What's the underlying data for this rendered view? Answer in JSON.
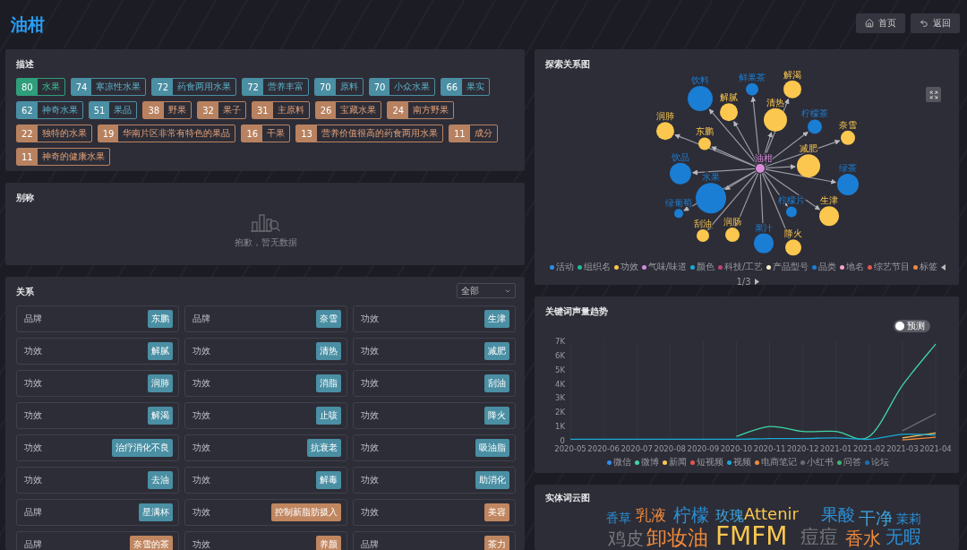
{
  "header": {
    "title": "油柑",
    "buttons": [
      {
        "kind": "home",
        "label": "首页"
      },
      {
        "kind": "back",
        "label": "返回"
      }
    ]
  },
  "description": {
    "title": "描述",
    "tags": [
      {
        "count": "80",
        "label": "水果",
        "color": "#2f9e7a"
      },
      {
        "count": "74",
        "label": "寒凉性水果",
        "color": "#4a8fa3"
      },
      {
        "count": "72",
        "label": "药食两用水果",
        "color": "#4a8fa3"
      },
      {
        "count": "72",
        "label": "营养丰富",
        "color": "#4a8fa3"
      },
      {
        "count": "70",
        "label": "原料",
        "color": "#4a8fa3"
      },
      {
        "count": "70",
        "label": "小众水果",
        "color": "#4a8fa3"
      },
      {
        "count": "66",
        "label": "果实",
        "color": "#4a8fa3"
      },
      {
        "count": "62",
        "label": "神奇水果",
        "color": "#4a8fa3"
      },
      {
        "count": "51",
        "label": "果品",
        "color": "#4a8fa3"
      },
      {
        "count": "38",
        "label": "野果",
        "color": "#b88260"
      },
      {
        "count": "32",
        "label": "果子",
        "color": "#b88260"
      },
      {
        "count": "31",
        "label": "主原料",
        "color": "#b88260"
      },
      {
        "count": "26",
        "label": "宝藏水果",
        "color": "#b88260"
      },
      {
        "count": "24",
        "label": "南方野果",
        "color": "#b88260"
      },
      {
        "count": "22",
        "label": "独特的水果",
        "color": "#b88260"
      },
      {
        "count": "19",
        "label": "华南片区非常有特色的果品",
        "color": "#b88260"
      },
      {
        "count": "16",
        "label": "干果",
        "color": "#b88260"
      },
      {
        "count": "13",
        "label": "营养价值很高的药食两用水果",
        "color": "#b88260"
      },
      {
        "count": "11",
        "label": "成分",
        "color": "#b88260"
      },
      {
        "count": "11",
        "label": "神奇的健康水果",
        "color": "#b88260"
      }
    ]
  },
  "alias": {
    "title": "别称",
    "empty_text": "抱歉，暂无数据"
  },
  "relations": {
    "title": "关系",
    "filter": "全部",
    "items": [
      {
        "type": "品牌",
        "value": "东鹏",
        "color": "#4a8fa3"
      },
      {
        "type": "品牌",
        "value": "奈雪",
        "color": "#4a8fa3"
      },
      {
        "type": "功效",
        "value": "生津",
        "color": "#4a8fa3"
      },
      {
        "type": "功效",
        "value": "解腻",
        "color": "#4a8fa3"
      },
      {
        "type": "功效",
        "value": "清热",
        "color": "#4a8fa3"
      },
      {
        "type": "功效",
        "value": "减肥",
        "color": "#4a8fa3"
      },
      {
        "type": "功效",
        "value": "润肺",
        "color": "#4a8fa3"
      },
      {
        "type": "功效",
        "value": "消脂",
        "color": "#4a8fa3"
      },
      {
        "type": "功效",
        "value": "刮油",
        "color": "#4a8fa3"
      },
      {
        "type": "功效",
        "value": "解渴",
        "color": "#4a8fa3"
      },
      {
        "type": "功效",
        "value": "止咳",
        "color": "#4a8fa3"
      },
      {
        "type": "功效",
        "value": "降火",
        "color": "#4a8fa3"
      },
      {
        "type": "功效",
        "value": "治疗消化不良",
        "color": "#4a8fa3"
      },
      {
        "type": "功效",
        "value": "抗衰老",
        "color": "#4a8fa3"
      },
      {
        "type": "功效",
        "value": "吸油脂",
        "color": "#4a8fa3"
      },
      {
        "type": "功效",
        "value": "去油",
        "color": "#4a8fa3"
      },
      {
        "type": "功效",
        "value": "解毒",
        "color": "#4a8fa3"
      },
      {
        "type": "功效",
        "value": "助消化",
        "color": "#4a8fa3"
      },
      {
        "type": "品牌",
        "value": "星满杯",
        "color": "#4a8fa3"
      },
      {
        "type": "功效",
        "value": "控制新脂肪摄入",
        "color": "#c08660"
      },
      {
        "type": "功效",
        "value": "美容",
        "color": "#c08660"
      },
      {
        "type": "品牌",
        "value": "奈雪的茶",
        "color": "#c08660"
      },
      {
        "type": "功效",
        "value": "养颜",
        "color": "#c08660"
      },
      {
        "type": "品牌",
        "value": "茶力",
        "color": "#c08660"
      }
    ]
  },
  "graph": {
    "title": "探索关系图",
    "center": {
      "label": "油柑",
      "color": "#d98bd9"
    },
    "nodes": [
      {
        "label": "饮料",
        "color": "#1a7ed4"
      },
      {
        "label": "鲜果茶",
        "color": "#1a7ed4"
      },
      {
        "label": "解渴",
        "color": "#fbc74e"
      },
      {
        "label": "解腻",
        "color": "#fbc74e"
      },
      {
        "label": "清热",
        "color": "#fbc74e"
      },
      {
        "label": "柠檬茶",
        "color": "#1a7ed4"
      },
      {
        "label": "润肺",
        "color": "#fbc74e"
      },
      {
        "label": "东鹏",
        "color": "#fbc74e"
      },
      {
        "label": "奈雪",
        "color": "#fbc74e"
      },
      {
        "label": "减肥",
        "color": "#fbc74e"
      },
      {
        "label": "饮品",
        "color": "#1a7ed4"
      },
      {
        "label": "绿茶",
        "color": "#1a7ed4"
      },
      {
        "label": "水果",
        "color": "#1a7ed4"
      },
      {
        "label": "绿葡萄",
        "color": "#1a7ed4"
      },
      {
        "label": "柠檬片",
        "color": "#1a7ed4"
      },
      {
        "label": "刮油",
        "color": "#fbc74e"
      },
      {
        "label": "润肠",
        "color": "#fbc74e"
      },
      {
        "label": "果汁",
        "color": "#1a7ed4"
      },
      {
        "label": "降火",
        "color": "#fbc74e"
      },
      {
        "label": "生津",
        "color": "#fbc74e"
      }
    ],
    "legend": [
      {
        "label": "活动",
        "color": "#2d8cf0"
      },
      {
        "label": "组织名",
        "color": "#19be9b"
      },
      {
        "label": "功效",
        "color": "#fbc74e"
      },
      {
        "label": "气味/味道",
        "color": "#d58ce0"
      },
      {
        "label": "颜色",
        "color": "#19a9d5"
      },
      {
        "label": "科技/工艺",
        "color": "#c0417c"
      },
      {
        "label": "产品型号",
        "color": "#fcf3cf"
      },
      {
        "label": "品类",
        "color": "#1a7ed4"
      },
      {
        "label": "地名",
        "color": "#f3a6c8"
      },
      {
        "label": "综艺节目",
        "color": "#e4574e"
      },
      {
        "label": "标签",
        "color": "#f08a3a"
      }
    ],
    "pager": "1/3"
  },
  "trend": {
    "title": "关键词声量趋势",
    "forecast": {
      "label": "预测",
      "on": false
    },
    "chart_data": {
      "type": "line",
      "grid": true,
      "categories": [
        "2020-05",
        "2020-06",
        "2020-07",
        "2020-08",
        "2020-09",
        "2020-10",
        "2020-11",
        "2020-12",
        "2021-01",
        "2021-02",
        "2021-03",
        "2021-04"
      ],
      "ylim": [
        0,
        7000
      ],
      "yticks": [
        {
          "value": 0,
          "label": "0"
        },
        {
          "value": 1000,
          "label": "1K"
        },
        {
          "value": 2000,
          "label": "2K"
        },
        {
          "value": 3000,
          "label": "3K"
        },
        {
          "value": 4000,
          "label": "4K"
        },
        {
          "value": 5000,
          "label": "5K"
        },
        {
          "value": 6000,
          "label": "6K"
        },
        {
          "value": 7000,
          "label": "7K"
        }
      ],
      "series": [
        {
          "name": "微信",
          "color": "#2d8cf0",
          "values": [
            null,
            null,
            null,
            null,
            null,
            null,
            null,
            null,
            null,
            null,
            null,
            null
          ]
        },
        {
          "name": "微博",
          "color": "#3fd5a5",
          "values": [
            null,
            null,
            null,
            null,
            null,
            300,
            1000,
            650,
            650,
            300,
            3900,
            6800
          ]
        },
        {
          "name": "新闻",
          "color": "#fbc74e",
          "values": [
            null,
            null,
            null,
            null,
            null,
            null,
            null,
            null,
            null,
            null,
            200,
            550
          ]
        },
        {
          "name": "短视频",
          "color": "#e4574e",
          "values": [
            null,
            null,
            null,
            null,
            null,
            null,
            null,
            null,
            null,
            null,
            null,
            null
          ]
        },
        {
          "name": "视频",
          "color": "#19a9d5",
          "values": [
            100,
            100,
            100,
            100,
            100,
            100,
            150,
            150,
            200,
            100,
            450,
            400
          ]
        },
        {
          "name": "电商笔记",
          "color": "#f08a3a",
          "values": [
            null,
            null,
            null,
            null,
            null,
            null,
            null,
            null,
            null,
            null,
            50,
            250
          ]
        },
        {
          "name": "小红书",
          "color": "#6b6b73",
          "values": [
            null,
            null,
            null,
            null,
            null,
            null,
            null,
            null,
            null,
            null,
            700,
            1900
          ]
        },
        {
          "name": "问答",
          "color": "#3cb371",
          "values": [
            null,
            null,
            null,
            null,
            null,
            null,
            null,
            null,
            null,
            null,
            null,
            null
          ]
        },
        {
          "name": "论坛",
          "color": "#1a6fb5",
          "values": [
            null,
            null,
            null,
            null,
            null,
            null,
            null,
            null,
            null,
            null,
            null,
            null
          ]
        }
      ]
    }
  },
  "wordcloud": {
    "title": "实体词云图",
    "words": [
      {
        "text": "香草",
        "color": "#2a8fd6"
      },
      {
        "text": "乳液",
        "color": "#f08a3a"
      },
      {
        "text": "柠檬",
        "color": "#2a8fd6"
      },
      {
        "text": "玫瑰",
        "color": "#3aa8e0"
      },
      {
        "text": "Attenir",
        "color": "#fbc74e"
      },
      {
        "text": "果酸",
        "color": "#2a8fd6"
      },
      {
        "text": "干净",
        "color": "#3aa8e0"
      },
      {
        "text": "茉莉",
        "color": "#2a8fd6"
      },
      {
        "text": "鸡皮",
        "color": "#77777d"
      },
      {
        "text": "卸妆油",
        "color": "#f08a3a"
      },
      {
        "text": "FMFM",
        "color": "#fbc74e"
      },
      {
        "text": "痘痘",
        "color": "#77777d"
      },
      {
        "text": "香水",
        "color": "#f08a3a"
      },
      {
        "text": "无暇",
        "color": "#2a8fd6"
      }
    ]
  }
}
